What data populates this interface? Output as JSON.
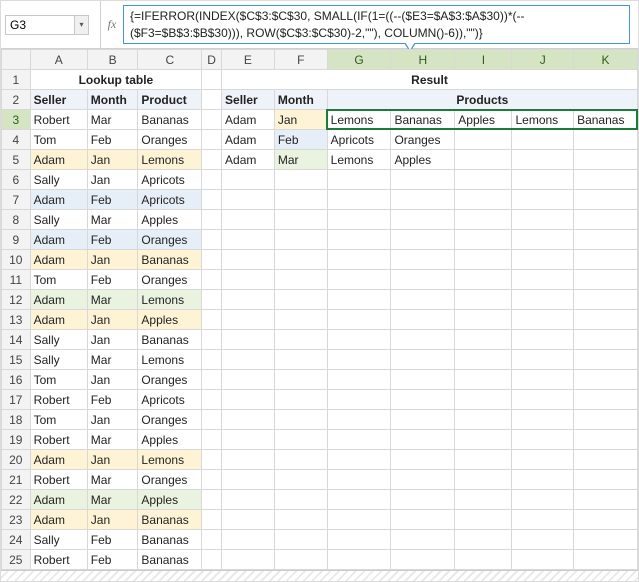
{
  "name_box": "G3",
  "formula": "{=IFERROR(INDEX($C$3:$C$30, SMALL(IF(1=((--($E3=$A$3:$A$30))*(--($F3=$B$3:$B$30))), ROW($C$3:$C$30)-2,\"\"), COLUMN()-6)),\"\")}",
  "columns": [
    "A",
    "B",
    "C",
    "D",
    "E",
    "F",
    "G",
    "H",
    "I",
    "J",
    "K"
  ],
  "row_numbers": [
    1,
    2,
    3,
    4,
    5,
    6,
    7,
    8,
    9,
    10,
    11,
    12,
    13,
    14,
    15,
    16,
    17,
    18,
    19,
    20,
    21,
    22,
    23,
    24,
    25
  ],
  "titles": {
    "lookup": "Lookup table",
    "result": "Result",
    "seller": "Seller",
    "month": "Month",
    "product": "Product",
    "products": "Products"
  },
  "lookup": [
    {
      "seller": "Robert",
      "month": "Mar",
      "product": "Bananas",
      "hl": ""
    },
    {
      "seller": "Tom",
      "month": "Feb",
      "product": "Oranges",
      "hl": ""
    },
    {
      "seller": "Adam",
      "month": "Jan",
      "product": "Lemons",
      "hl": "tan"
    },
    {
      "seller": "Sally",
      "month": "Jan",
      "product": "Apricots",
      "hl": ""
    },
    {
      "seller": "Adam",
      "month": "Feb",
      "product": "Apricots",
      "hl": "blue"
    },
    {
      "seller": "Sally",
      "month": "Mar",
      "product": "Apples",
      "hl": ""
    },
    {
      "seller": "Adam",
      "month": "Feb",
      "product": "Oranges",
      "hl": "blue"
    },
    {
      "seller": "Adam",
      "month": "Jan",
      "product": "Bananas",
      "hl": "tan"
    },
    {
      "seller": "Tom",
      "month": "Feb",
      "product": "Oranges",
      "hl": ""
    },
    {
      "seller": "Adam",
      "month": "Mar",
      "product": "Lemons",
      "hl": "green"
    },
    {
      "seller": "Adam",
      "month": "Jan",
      "product": "Apples",
      "hl": "tan"
    },
    {
      "seller": "Sally",
      "month": "Jan",
      "product": "Bananas",
      "hl": ""
    },
    {
      "seller": "Sally",
      "month": "Mar",
      "product": "Lemons",
      "hl": ""
    },
    {
      "seller": "Tom",
      "month": "Jan",
      "product": "Oranges",
      "hl": ""
    },
    {
      "seller": "Robert",
      "month": "Feb",
      "product": "Apricots",
      "hl": ""
    },
    {
      "seller": "Tom",
      "month": "Jan",
      "product": "Oranges",
      "hl": ""
    },
    {
      "seller": "Robert",
      "month": "Mar",
      "product": "Apples",
      "hl": ""
    },
    {
      "seller": "Adam",
      "month": "Jan",
      "product": "Lemons",
      "hl": "tan"
    },
    {
      "seller": "Robert",
      "month": "Mar",
      "product": "Oranges",
      "hl": ""
    },
    {
      "seller": "Adam",
      "month": "Mar",
      "product": "Apples",
      "hl": "green"
    },
    {
      "seller": "Adam",
      "month": "Jan",
      "product": "Bananas",
      "hl": "tan"
    },
    {
      "seller": "Sally",
      "month": "Feb",
      "product": "Bananas",
      "hl": ""
    },
    {
      "seller": "Robert",
      "month": "Feb",
      "product": "Bananas",
      "hl": ""
    }
  ],
  "query": [
    {
      "seller": "Adam",
      "month": "Jan",
      "hl": "tan"
    },
    {
      "seller": "Adam",
      "month": "Feb",
      "hl": "blue"
    },
    {
      "seller": "Adam",
      "month": "Mar",
      "hl": "green"
    }
  ],
  "results": [
    [
      "Lemons",
      "Bananas",
      "Apples",
      "Lemons",
      "Bananas"
    ],
    [
      "Apricots",
      "Oranges",
      "",
      "",
      ""
    ],
    [
      "Lemons",
      "Apples",
      "",
      "",
      ""
    ]
  ],
  "selection": {
    "row": 3,
    "cols": [
      "G",
      "H",
      "I",
      "J",
      "K"
    ],
    "active": "G3"
  }
}
